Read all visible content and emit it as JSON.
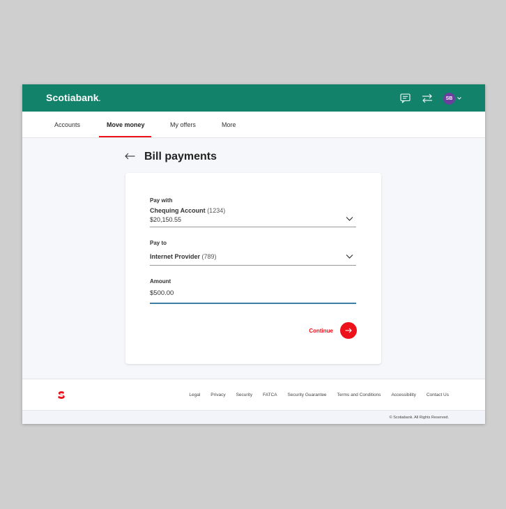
{
  "header": {
    "logo": "Scotiabank",
    "logo_mark": ".",
    "avatar_initials": "SB",
    "icons": [
      "chat-icon",
      "transfer-icon",
      "chevron-down-icon"
    ]
  },
  "nav": {
    "items": [
      {
        "label": "Accounts"
      },
      {
        "label": "Move money"
      },
      {
        "label": "My offers"
      },
      {
        "label": "More"
      }
    ],
    "active": "Move money"
  },
  "page": {
    "title": "Bill payments"
  },
  "form": {
    "pay_with": {
      "label": "Pay with",
      "account_name": "Chequing Account",
      "account_number": "(1234)",
      "balance": "$20,150.55"
    },
    "pay_to": {
      "label": "Pay to",
      "payee_name": "Internet Provider",
      "payee_number": "(789)"
    },
    "amount": {
      "label": "Amount",
      "value": "$500.00"
    },
    "continue_label": "Continue"
  },
  "footer": {
    "links": [
      "Legal",
      "Privacy",
      "Security",
      "FATCA",
      "Security Guarantee",
      "Terms and Conditions",
      "Accessibility",
      "Contact Us"
    ],
    "copyright": "© Scotiabank. All Rights Reserved."
  },
  "colors": {
    "brand_green": "#13826a",
    "accent_red": "#ec111a",
    "avatar_purple": "#6b3fa0",
    "focus_blue": "#3b7fa3"
  }
}
